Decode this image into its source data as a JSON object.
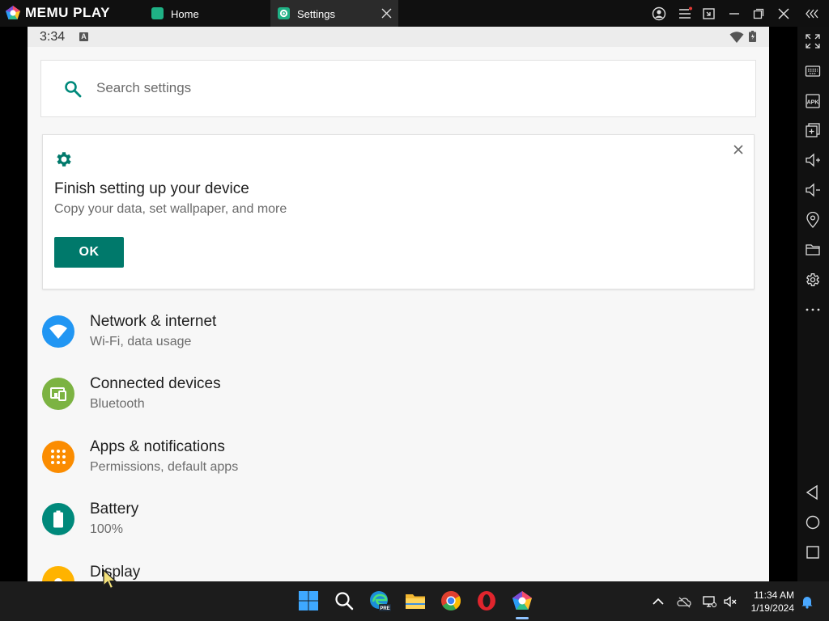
{
  "window": {
    "brand": "MEMU PLAY",
    "tabs": [
      {
        "label": "Home",
        "active": false
      },
      {
        "label": "Settings",
        "active": true
      }
    ]
  },
  "status_bar": {
    "time": "3:34",
    "notification_letter": "A"
  },
  "search": {
    "placeholder": "Search settings"
  },
  "setup_card": {
    "title": "Finish setting up your device",
    "subtitle": "Copy your data, set wallpaper, and more",
    "ok_label": "OK"
  },
  "settings_items": [
    {
      "title": "Network & internet",
      "subtitle": "Wi-Fi, data usage",
      "icon": "wifi-icon",
      "color": "#2196f3"
    },
    {
      "title": "Connected devices",
      "subtitle": "Bluetooth",
      "icon": "devices-icon",
      "color": "#7cb342"
    },
    {
      "title": "Apps & notifications",
      "subtitle": "Permissions, default apps",
      "icon": "apps-icon",
      "color": "#fb8c00"
    },
    {
      "title": "Battery",
      "subtitle": "100%",
      "icon": "battery-icon",
      "color": "#00897b"
    },
    {
      "title": "Display",
      "subtitle": "",
      "icon": "display-icon",
      "color": "#ffb300"
    }
  ],
  "sidebar": {
    "icons": [
      "fullscreen-icon",
      "keyboard-icon",
      "apk-icon",
      "multi-instance-icon",
      "volume-up-icon",
      "volume-down-icon",
      "location-icon",
      "folder-icon",
      "settings-icon",
      "more-icon",
      "back-icon",
      "home-icon",
      "recents-icon"
    ],
    "apk_label": "APK"
  },
  "taskbar": {
    "time": "11:34 AM",
    "date": "1/19/2024",
    "edge_badge": "PRE"
  },
  "colors": {
    "accent": "#00796b",
    "android_bg": "#f7f7f7"
  }
}
